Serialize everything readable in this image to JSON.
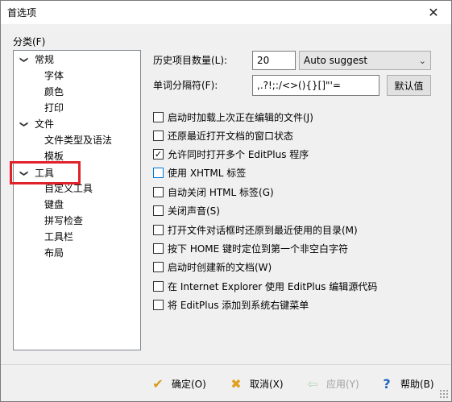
{
  "window": {
    "title": "首选项",
    "close_glyph": "✕"
  },
  "category": {
    "label": "分类(F)",
    "tree": [
      {
        "label": "常规",
        "level": 0,
        "expanded": true
      },
      {
        "label": "字体",
        "level": 1
      },
      {
        "label": "颜色",
        "level": 1
      },
      {
        "label": "打印",
        "level": 1
      },
      {
        "label": "文件",
        "level": 0,
        "expanded": true
      },
      {
        "label": "文件类型及语法",
        "level": 1
      },
      {
        "label": "模板",
        "level": 1
      },
      {
        "label": "工具",
        "level": 0,
        "expanded": true,
        "highlighted": true
      },
      {
        "label": "自定义工具",
        "level": 1
      },
      {
        "label": "键盘",
        "level": 1
      },
      {
        "label": "拼写检查",
        "level": 1
      },
      {
        "label": "工具栏",
        "level": 1
      },
      {
        "label": "布局",
        "level": 1
      }
    ]
  },
  "settings": {
    "history_label": "历史项目数量(L):",
    "history_value": "20",
    "history_mode": "Auto suggest",
    "delimiter_label": "单词分隔符(F):",
    "delimiter_value": ",.?!;:/<>(){}[]\"'=",
    "default_button": "默认值",
    "checkboxes": [
      {
        "label": "启动时加载上次正在编辑的文件(J)",
        "checked": false
      },
      {
        "label": "还原最近打开文档的窗口状态",
        "checked": false
      },
      {
        "label": "允许同时打开多个 EditPlus 程序",
        "checked": true
      },
      {
        "label": "使用 XHTML 标签",
        "checked": false,
        "focused": true
      },
      {
        "label": "自动关闭 HTML 标签(G)",
        "checked": false
      },
      {
        "label": "关闭声音(S)",
        "checked": false
      },
      {
        "label": "打开文件对话框时还原到最近使用的目录(M)",
        "checked": false
      },
      {
        "label": "按下 HOME 键时定位到第一个非空白字符",
        "checked": false
      },
      {
        "label": "启动时创建新的文档(W)",
        "checked": false
      },
      {
        "label": "在 Internet Explorer 使用 EditPlus 编辑源代码",
        "checked": false
      },
      {
        "label": "将 EditPlus 添加到系统右键菜单",
        "checked": false
      }
    ]
  },
  "footer": {
    "ok": "确定(O)",
    "cancel": "取消(X)",
    "apply": "应用(Y)",
    "help": "帮助(B)"
  },
  "colors": {
    "highlight_box": "#e0232b",
    "ok_icon": "#d89a1c",
    "cancel_icon": "#e0a020",
    "help_icon": "#1e63c4"
  }
}
